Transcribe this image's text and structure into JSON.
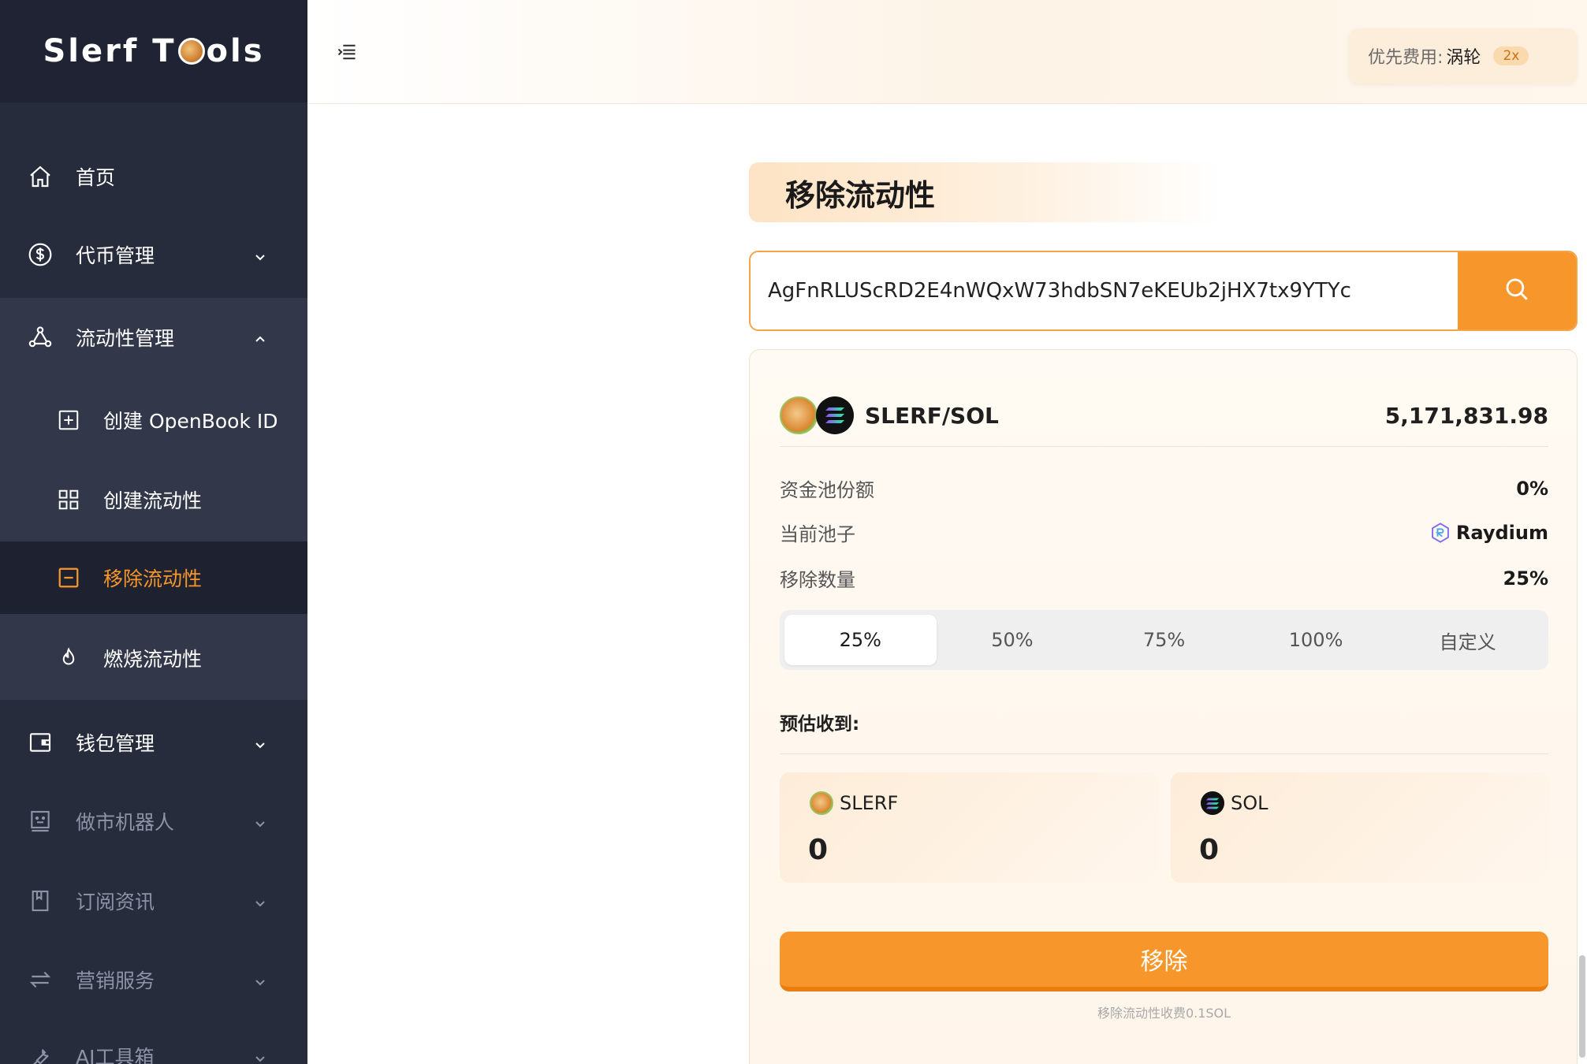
{
  "app": {
    "logo_text_left": "Slerf T",
    "logo_text_right": "ols"
  },
  "sidebar": {
    "items": [
      {
        "label": "首页"
      },
      {
        "label": "代币管理"
      },
      {
        "label": "流动性管理"
      },
      {
        "label": "创建 OpenBook ID"
      },
      {
        "label": "创建流动性"
      },
      {
        "label": "移除流动性"
      },
      {
        "label": "燃烧流动性"
      },
      {
        "label": "钱包管理"
      },
      {
        "label": "做市机器人"
      },
      {
        "label": "订阅资讯"
      },
      {
        "label": "营销服务"
      },
      {
        "label": "AI工具箱"
      }
    ]
  },
  "header": {
    "fee_label": "优先费用:",
    "fee_value": "涡轮",
    "fee_badge": "2x"
  },
  "main": {
    "title": "移除流动性",
    "search_value": "AgFnRLUScRD2E4nWQxW73hdbSN7eKEUb2jHX7tx9YTYc",
    "pair": {
      "name": "SLERF/SOL",
      "value": "5,171,831.98"
    },
    "rows": [
      {
        "key": "资金池份额",
        "value": "0%"
      },
      {
        "key": "当前池子",
        "value": "Raydium"
      },
      {
        "key": "移除数量",
        "value": "25%"
      }
    ],
    "percent_options": [
      "25%",
      "50%",
      "75%",
      "100%",
      "自定义"
    ],
    "selected_percent": "25%",
    "estimate_label": "预估收到:",
    "estimates": [
      {
        "token": "SLERF",
        "amount": "0"
      },
      {
        "token": "SOL",
        "amount": "0"
      }
    ],
    "remove_button": "移除",
    "fee_note": "移除流动性收费0.1SOL"
  },
  "colors": {
    "accent": "#f7962a",
    "sidebar_bg": "#272c3d",
    "logo_bg": "#1f2333"
  }
}
